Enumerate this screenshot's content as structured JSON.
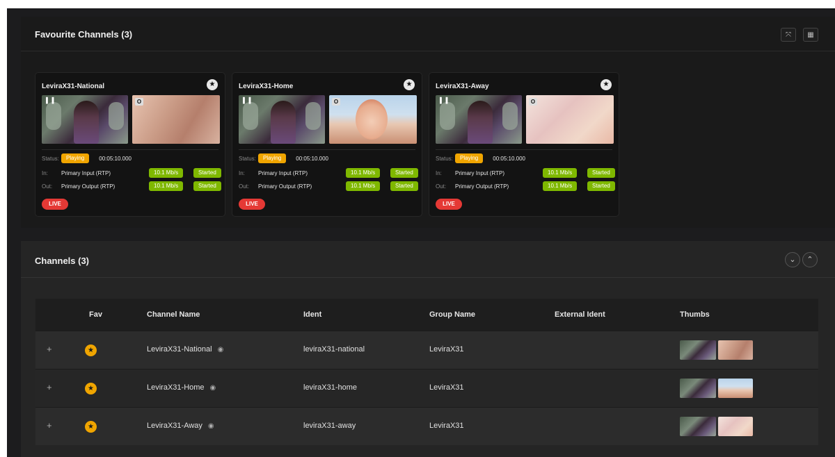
{
  "favourites": {
    "title": "Favourite Channels (3)",
    "expand_icon": "expand-icon",
    "grid_icon": "grid-icon",
    "cards": [
      {
        "name": "LeviraX31-National",
        "status_label": "Status:",
        "status": "Playing",
        "time": "00:05:10.000",
        "in_label": "In:",
        "in_name": "Primary Input (RTP)",
        "in_rate": "10.1 Mb/s",
        "in_state": "Started",
        "out_label": "Out:",
        "out_name": "Primary Output (RTP)",
        "out_rate": "10.1 Mb/s",
        "out_state": "Started",
        "live": "LIVE",
        "thumb_tag": "O"
      },
      {
        "name": "LeviraX31-Home",
        "status_label": "Status:",
        "status": "Playing",
        "time": "00:05:10.000",
        "in_label": "In:",
        "in_name": "Primary Input (RTP)",
        "in_rate": "10.1 Mb/s",
        "in_state": "Started",
        "out_label": "Out:",
        "out_name": "Primary Output (RTP)",
        "out_rate": "10.1 Mb/s",
        "out_state": "Started",
        "live": "LIVE",
        "thumb_tag": "O"
      },
      {
        "name": "LeviraX31-Away",
        "status_label": "Status:",
        "status": "Playing",
        "time": "00:05:10.000",
        "in_label": "In:",
        "in_name": "Primary Input (RTP)",
        "in_rate": "10.1 Mb/s",
        "in_state": "Started",
        "out_label": "Out:",
        "out_name": "Primary Output (RTP)",
        "out_rate": "10.1 Mb/s",
        "out_state": "Started",
        "live": "LIVE",
        "thumb_tag": "O"
      }
    ]
  },
  "channels": {
    "title": "Channels (3)",
    "columns": [
      "Fav",
      "Channel Name",
      "Ident",
      "Group Name",
      "External Ident",
      "Thumbs"
    ],
    "rows": [
      {
        "name": "LeviraX31-National",
        "ident": "leviraX31-national",
        "group": "LeviraX31",
        "external": ""
      },
      {
        "name": "LeviraX31-Home",
        "ident": "leviraX31-home",
        "group": "LeviraX31",
        "external": ""
      },
      {
        "name": "LeviraX31-Away",
        "ident": "leviraX31-away",
        "group": "LeviraX31",
        "external": ""
      }
    ]
  },
  "colors": {
    "accent_orange": "#f0a500",
    "status_green": "#7fb800",
    "live_red": "#e53935",
    "background": "#1c1c1e"
  }
}
